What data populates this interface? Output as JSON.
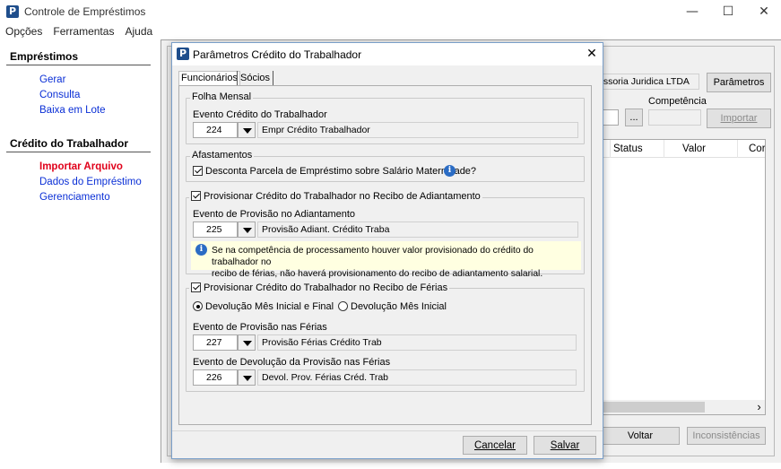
{
  "window": {
    "title": "Controle de Empréstimos",
    "minimize": "—",
    "maximize": "☐",
    "close": "✕"
  },
  "menu": [
    "Opções",
    "Ferramentas",
    "Ajuda"
  ],
  "sidebar": {
    "section1": {
      "title": "Empréstimos",
      "items": [
        "Gerar",
        "Consulta",
        "Baixa em Lote"
      ]
    },
    "section2": {
      "title": "Crédito do Trabalhador",
      "items": [
        "Importar Arquivo",
        "Dados do Empréstimo",
        "Gerenciamento"
      ],
      "active_index": 0
    }
  },
  "background_panel": {
    "company": "essoria Juridica LTDA",
    "parametros_button": "Parâmetros",
    "competencia_label": "Competência",
    "browse_button": "...",
    "importar_button": "Importar",
    "columns": [
      "Status",
      "Valor",
      "Cor"
    ],
    "scroll_arrow": "›",
    "voltar_button": "Voltar",
    "inconsistencias_button": "Inconsistências"
  },
  "dialog": {
    "title": "Parâmetros Crédito do Trabalhador",
    "tabs": [
      "Funcionários",
      "Sócios"
    ],
    "active_tab": 0,
    "folha": {
      "group_title": "Folha Mensal",
      "label": "Evento Crédito do Trabalhador",
      "code": "224",
      "description": "Empr Crédito Trabalhador"
    },
    "afastamentos": {
      "group_title": "Afastamentos",
      "checkbox_label": "Desconta Parcela de Empréstimo sobre Salário Maternidade?",
      "checked": true
    },
    "adiantamento": {
      "group_title": "Provisionar Crédito do Trabalhador no Recibo de Adiantamento",
      "checked": true,
      "label": "Evento de Provisão no Adiantamento",
      "code": "225",
      "description": "Provisão Adiant. Crédito Traba",
      "info_line1": "Se na competência de processamento houver valor provisionado do crédito do trabalhador no",
      "info_line2": "recibo de férias, não haverá provisionamento do recibo de adiantamento salarial."
    },
    "ferias": {
      "group_title": "Provisionar Crédito do Trabalhador no Recibo de Férias",
      "checked": true,
      "radio1": "Devolução Mês Inicial e Final",
      "radio2": "Devolução Mês Inicial",
      "selected_radio": 0,
      "provisao_label": "Evento de Provisão nas Férias",
      "provisao_code": "227",
      "provisao_description": "Provisão Férias Crédito Trab",
      "devolucao_label": "Evento de Devolução da Provisão nas Férias",
      "devolucao_code": "226",
      "devolucao_description": "Devol. Prov. Férias Créd. Trab"
    },
    "cancel_button": "Cancelar",
    "save_button": "Salvar",
    "close": "✕",
    "info_glyph": "i"
  },
  "colors": {
    "link": "#0a2fd6",
    "active_link": "#e0001a",
    "info_bg": "#ffffe1",
    "info_icon": "#2b6cc4"
  }
}
